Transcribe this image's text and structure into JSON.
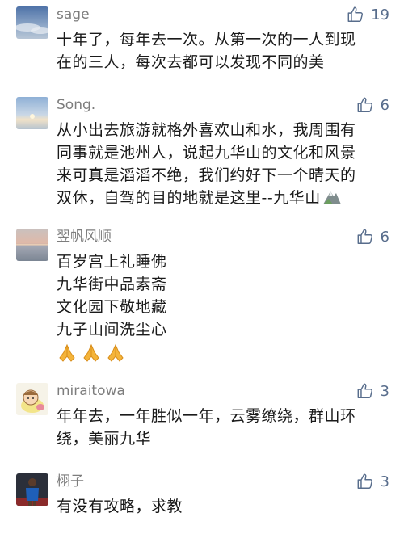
{
  "comments": [
    {
      "username": "sage",
      "likes": "19",
      "lines": [
        "十年了，每年去一次。从第一次的一人到现",
        "在的三人，每次去都可以发现不同的美"
      ]
    },
    {
      "username": "Song.",
      "likes": "6",
      "lines": [
        "从小出去旅游就格外喜欢山和水，我周围有",
        "同事就是池州人，说起九华山的文化和风景",
        "来可真是滔滔不绝，我们约好下一个晴天的",
        "双休，自驾的目的地就是这里--九华山"
      ],
      "trailing_emoji": "mountain-emoji"
    },
    {
      "username": "翌帆风顺",
      "likes": "6",
      "lines": [
        "百岁宫上礼睡佛",
        "九华街中品素斋",
        "文化园下敬地藏",
        "九子山间洗尘心"
      ],
      "emoji_row": [
        "folded-hands-emoji",
        "folded-hands-emoji",
        "folded-hands-emoji"
      ]
    },
    {
      "username": "miraitowa",
      "likes": "3",
      "lines": [
        "年年去，一年胜似一年，云雾缭绕，群山环",
        "绕，美丽九华"
      ]
    },
    {
      "username": "栩子",
      "likes": "3",
      "lines": [
        "有没有攻略，求教"
      ]
    }
  ],
  "colors": {
    "username": "#7d7d7d",
    "like": "#586d8c",
    "text": "#1a1a1a"
  }
}
